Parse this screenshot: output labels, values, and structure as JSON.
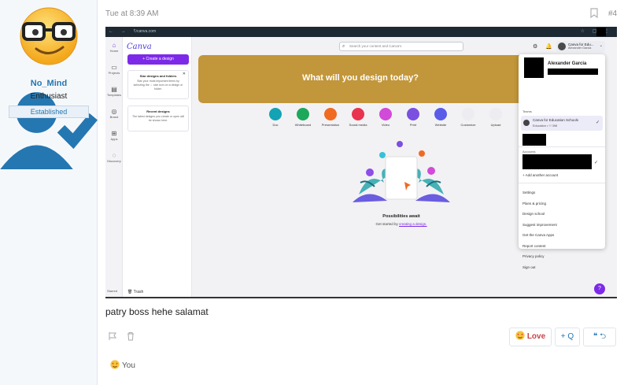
{
  "user": {
    "name": "No_Mind",
    "title": "Enthusiast",
    "badge": "Established"
  },
  "post": {
    "time": "Tue at 8:39 AM",
    "number": "#4",
    "message": "patry boss hehe salamat",
    "love_label": "Love",
    "quote_label": "+ Q",
    "reactions_text": "You"
  },
  "canva": {
    "url": "canva.com",
    "logo": "Canva",
    "create_button": "+ Create a design",
    "rail": [
      "Home",
      "Projects",
      "Templates",
      "Brand",
      "Apps",
      "Discovery"
    ],
    "star_card": {
      "title": "Star designs and folders",
      "desc": "Star your most important items by selecting the ☆ star icon on a design or folder."
    },
    "recent_card": {
      "title": "Recent designs",
      "desc": "The latest designs you create or open will be shown here."
    },
    "trash_label": "Trash",
    "starred_label": "Starred",
    "search_placeholder": "Search your content and Canva's",
    "account_short": "Canva for Edu...",
    "account_sub": "Alexander Garcia",
    "banner": "What will you design today?",
    "categories": [
      {
        "label": "Doc",
        "color": "#13a3b5"
      },
      {
        "label": "Whiteboard",
        "color": "#1ea85b"
      },
      {
        "label": "Presentation",
        "color": "#f06a21"
      },
      {
        "label": "Social media",
        "color": "#e8344f"
      },
      {
        "label": "Video",
        "color": "#d14ad9"
      },
      {
        "label": "Print",
        "color": "#7b4fe0"
      },
      {
        "label": "Website",
        "color": "#5a5ce8"
      },
      {
        "label": "Customize",
        "color": "#ececf1"
      },
      {
        "label": "Upload",
        "color": "#ececf1"
      }
    ],
    "empty_title": "Possibilities await",
    "empty_desc": "Get started by",
    "empty_link": "creating a design.",
    "help": "?",
    "dropdown": {
      "name": "Alexander Garcia",
      "teams_label": "Teams",
      "team_name": "Canva for Education Schools",
      "team_sub": "Education • ⚇ 398",
      "accounts_label": "Accounts",
      "add_account": "+ Add another account",
      "menu": [
        "Settings",
        "Plans & pricing",
        "Design school",
        "Suggest improvement",
        "Get the Canva Apps",
        "Report content",
        "Privacy policy",
        "Sign out"
      ]
    }
  },
  "colors": {
    "accent": "#2577b1",
    "canva_purple": "#7d2ae8",
    "banner": "#c2963a",
    "love": "#c84448"
  }
}
